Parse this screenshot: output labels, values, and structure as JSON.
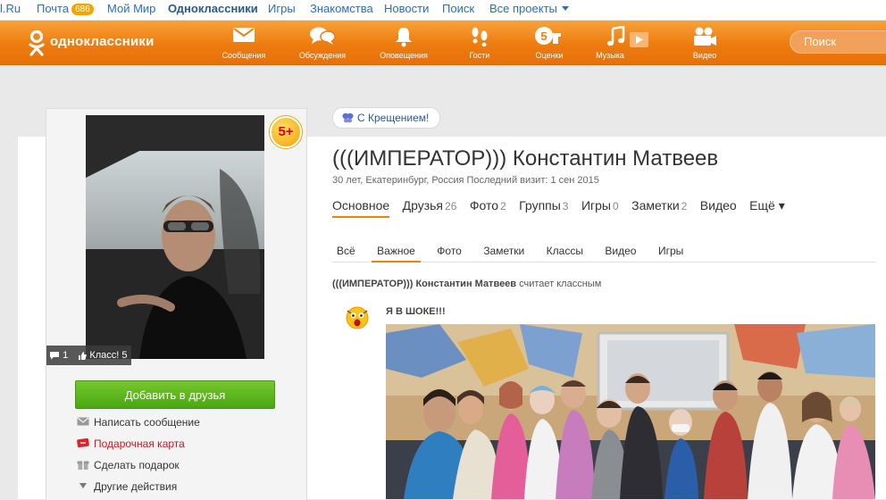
{
  "topbar": {
    "links": [
      "l.Ru",
      "Почта",
      "Мой Мир",
      "Одноклассники",
      "Игры",
      "Знакомства",
      "Новости",
      "Поиск",
      "Все проекты"
    ],
    "mail_badge": "686"
  },
  "toolbar": {
    "logo_text": "одноклассники",
    "items": [
      "Сообщения",
      "Обсуждения",
      "Оповещения",
      "Гости",
      "Оценки",
      "Музыка",
      "Видео"
    ],
    "search_placeholder": "Поиск"
  },
  "profile": {
    "age_badge": "5+",
    "photo_comments": "1",
    "photo_likes": "Класс! 5",
    "add_friend": "Добавить в друзья",
    "actions": [
      "Написать сообщение",
      "Подарочная карта",
      "Сделать подарок",
      "Другие действия"
    ],
    "holiday": "С Крещением!",
    "name": "(((ИМПЕРАТОР))) Константин Матвеев",
    "meta": "30 лет, Екатеринбург, Россия  Последний визит: 1 сен 2015",
    "tabs": [
      {
        "label": "Основное",
        "count": ""
      },
      {
        "label": "Друзья",
        "count": "26"
      },
      {
        "label": "Фото",
        "count": "2"
      },
      {
        "label": "Группы",
        "count": "3"
      },
      {
        "label": "Игры",
        "count": "0"
      },
      {
        "label": "Заметки",
        "count": "2"
      },
      {
        "label": "Видео",
        "count": ""
      },
      {
        "label": "Ещё ▾",
        "count": ""
      }
    ],
    "subtabs": [
      "Всё",
      "Важное",
      "Фото",
      "Заметки",
      "Классы",
      "Видео",
      "Игры"
    ]
  },
  "feed": {
    "author": "(((ИМПЕРАТОР))) Константин Матвеев",
    "action": " считает классным",
    "post_title": "Я В ШОКЕ!!!"
  },
  "colors": {
    "orange": "#ee7c0e",
    "link_blue": "#2a6ebb",
    "green_button": "#5cb81c",
    "active_tab_underline": "#ee8208"
  }
}
